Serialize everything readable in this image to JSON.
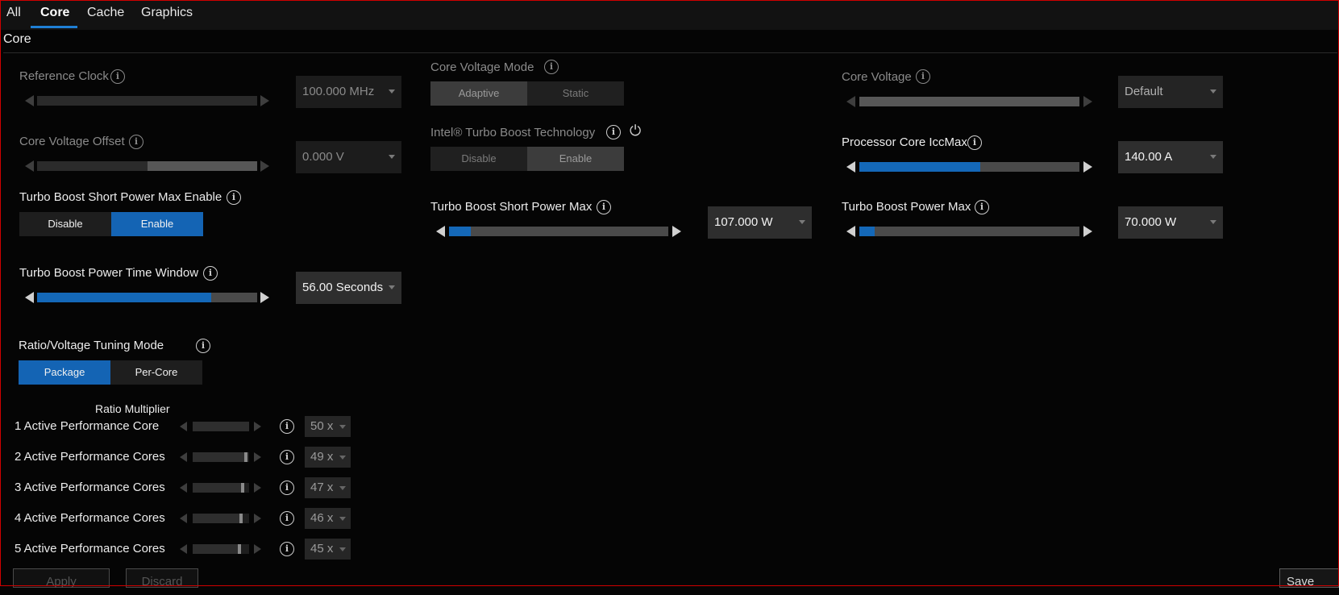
{
  "tabs": [
    {
      "label": "All"
    },
    {
      "label": "Core"
    },
    {
      "label": "Cache"
    },
    {
      "label": "Graphics"
    }
  ],
  "section_title": "Core",
  "settings": {
    "reference_clock": {
      "label": "Reference Clock",
      "value": "100.000 MHz",
      "slider": 0.0,
      "enabled": false
    },
    "core_voltage_offset": {
      "label": "Core Voltage Offset",
      "value": "0.000 V",
      "slider": 0.5,
      "enabled": false
    },
    "turbo_short_power_max_enable": {
      "label": "Turbo Boost Short Power Max Enable",
      "options": [
        "Disable",
        "Enable"
      ],
      "selected": "Enable"
    },
    "turbo_power_time_window": {
      "label": "Turbo Boost Power Time Window",
      "value": "56.00 Seconds",
      "slider": 0.79
    },
    "tuning_mode": {
      "label": "Ratio/Voltage Tuning Mode",
      "options": [
        "Package",
        "Per-Core"
      ],
      "selected": "Package"
    },
    "core_voltage_mode": {
      "label": "Core Voltage Mode",
      "options": [
        "Adaptive",
        "Static"
      ],
      "selected": "Adaptive",
      "enabled": false
    },
    "turbo_boost_technology": {
      "label": "Intel® Turbo Boost Technology",
      "options": [
        "Disable",
        "Enable"
      ],
      "selected": "Enable",
      "enabled": false
    },
    "turbo_short_power_max": {
      "label": "Turbo Boost Short Power Max",
      "value": "107.000 W",
      "slider": 0.1
    },
    "core_voltage": {
      "label": "Core Voltage",
      "value": "Default",
      "slider": 1.0,
      "enabled": false
    },
    "processor_core_iccmax": {
      "label": "Processor Core IccMax",
      "value": "140.00 A",
      "slider": 0.55
    },
    "turbo_power_max": {
      "label": "Turbo Boost Power Max",
      "value": "70.000 W",
      "slider": 0.07
    }
  },
  "ratio": {
    "title": "Ratio Multiplier",
    "rows": [
      {
        "label": "1 Active Performance Core",
        "value": "50 x",
        "level": 1.0
      },
      {
        "label": "2 Active Performance Cores",
        "value": "49 x",
        "level": 0.97
      },
      {
        "label": "3 Active Performance Cores",
        "value": "47 x",
        "level": 0.92
      },
      {
        "label": "4 Active Performance Cores",
        "value": "46 x",
        "level": 0.89
      },
      {
        "label": "5 Active Performance Cores",
        "value": "45 x",
        "level": 0.86
      }
    ]
  },
  "footer": {
    "apply": "Apply",
    "discard": "Discard",
    "save": "Save"
  },
  "colors": {
    "accent": "#1464b4",
    "border": "#d00000",
    "background": "#050505"
  }
}
